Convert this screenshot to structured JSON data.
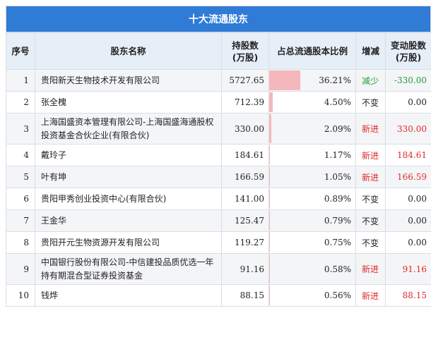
{
  "title": "十大流通股东",
  "headers": {
    "index": "序号",
    "name": "股东名称",
    "shares_line1": "持股数",
    "shares_line2": "(万股)",
    "ratio": "占总流通股本比例",
    "change": "增减",
    "delta_line1": "变动股数",
    "delta_line2": "(万股)"
  },
  "colors": {
    "header_bg": "#2f7bd6",
    "bar": "#f4b8bc",
    "up": "#e02a2a",
    "down": "#1f9d3a"
  },
  "rows": [
    {
      "index": "1",
      "name": "贵阳新天生物技术开发有限公司",
      "shares": "5727.65",
      "ratio": "36.21%",
      "ratio_value": 36.21,
      "change": "减少",
      "delta": "-330.00",
      "trend": "down"
    },
    {
      "index": "2",
      "name": "张全槐",
      "shares": "712.39",
      "ratio": "4.50%",
      "ratio_value": 4.5,
      "change": "不变",
      "delta": "0.00",
      "trend": "flat"
    },
    {
      "index": "3",
      "name": "上海国盛资本管理有限公司-上海国盛海通股权投资基金合伙企业(有限合伙)",
      "shares": "330.00",
      "ratio": "2.09%",
      "ratio_value": 2.09,
      "change": "新进",
      "delta": "330.00",
      "trend": "up"
    },
    {
      "index": "4",
      "name": "戴玲子",
      "shares": "184.61",
      "ratio": "1.17%",
      "ratio_value": 1.17,
      "change": "新进",
      "delta": "184.61",
      "trend": "up"
    },
    {
      "index": "5",
      "name": "叶有坤",
      "shares": "166.59",
      "ratio": "1.05%",
      "ratio_value": 1.05,
      "change": "新进",
      "delta": "166.59",
      "trend": "up"
    },
    {
      "index": "6",
      "name": "贵阳甲秀创业投资中心(有限合伙)",
      "shares": "141.00",
      "ratio": "0.89%",
      "ratio_value": 0.89,
      "change": "不变",
      "delta": "0.00",
      "trend": "flat"
    },
    {
      "index": "7",
      "name": "王金华",
      "shares": "125.47",
      "ratio": "0.79%",
      "ratio_value": 0.79,
      "change": "不变",
      "delta": "0.00",
      "trend": "flat"
    },
    {
      "index": "8",
      "name": "贵阳开元生物资源开发有限公司",
      "shares": "119.27",
      "ratio": "0.75%",
      "ratio_value": 0.75,
      "change": "不变",
      "delta": "0.00",
      "trend": "flat"
    },
    {
      "index": "9",
      "name": "中国银行股份有限公司-中信建投品质优选一年持有期混合型证券投资基金",
      "shares": "91.16",
      "ratio": "0.58%",
      "ratio_value": 0.58,
      "change": "新进",
      "delta": "91.16",
      "trend": "up"
    },
    {
      "index": "10",
      "name": "钱烨",
      "shares": "88.15",
      "ratio": "0.56%",
      "ratio_value": 0.56,
      "change": "新进",
      "delta": "88.15",
      "trend": "up"
    }
  ]
}
